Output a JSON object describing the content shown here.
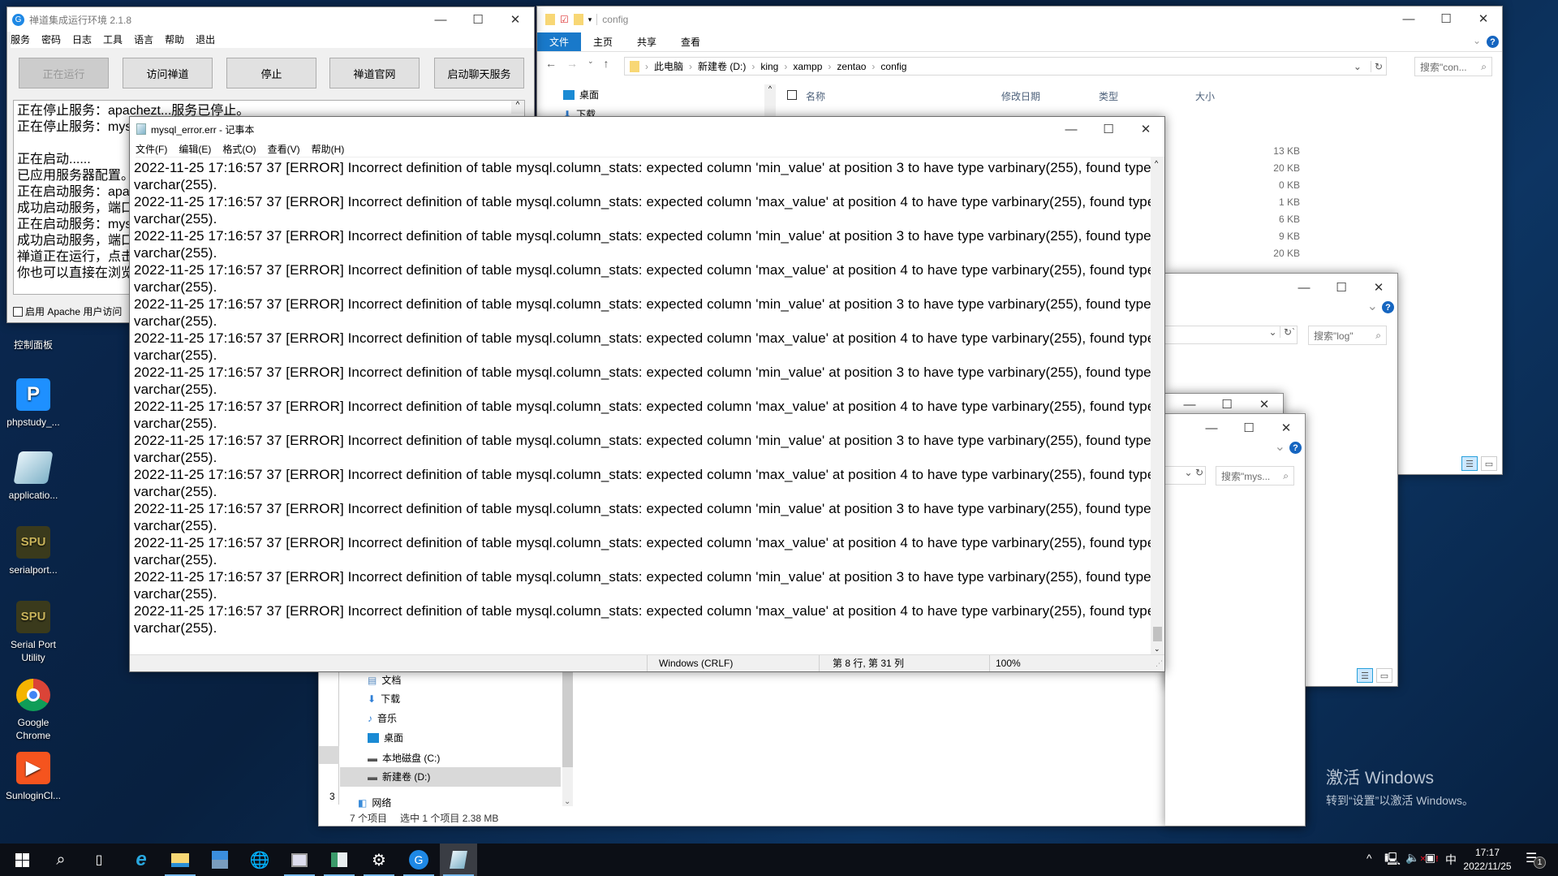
{
  "desktop": {
    "icons": [
      {
        "label": "控制面板",
        "icon": "control-panel-icon"
      },
      {
        "label": "phpstudy_...",
        "icon": "phpstudy-icon",
        "glyph": "P"
      },
      {
        "label": "applicatio...",
        "icon": "notepad-file-icon"
      },
      {
        "label": "serialport...",
        "icon": "serialport-icon",
        "glyph": "SPU"
      },
      {
        "label": "Serial Port Utility",
        "icon": "serialport-icon",
        "glyph": "SPU"
      },
      {
        "label": "Google Chrome",
        "icon": "chrome-icon"
      },
      {
        "label": "SunloginCl...",
        "icon": "sunlogin-icon"
      }
    ],
    "watermark": {
      "title": "激活 Windows",
      "subtitle": "转到“设置”以激活 Windows。"
    }
  },
  "zentao": {
    "title": "禅道集成运行环境 2.1.8",
    "menu": [
      "服务",
      "密码",
      "日志",
      "工具",
      "语言",
      "帮助",
      "退出"
    ],
    "buttons": [
      "正在运行",
      "访问禅道",
      "停止",
      "禅道官网",
      "启动聊天服务"
    ],
    "log": [
      "正在停止服务：apachezt...服务已停止。",
      "正在停止服务：mysql",
      "",
      "正在启动......",
      "已应用服务器配置。",
      "正在启动服务：apache",
      "成功启动服务，端口号",
      "正在启动服务：mysql",
      "成功启动服务，端口号",
      "禅道正在运行，点击“",
      "你也可以直接在浏览器"
    ],
    "checkbox_label": "启用 Apache 用户访问"
  },
  "notepad": {
    "title": "mysql_error.err - 记事本",
    "menu": [
      "文件(F)",
      "编辑(E)",
      "格式(O)",
      "查看(V)",
      "帮助(H)"
    ],
    "lines": [
      "2022-11-25 17:16:57 37 [ERROR] Incorrect definition of table mysql.column_stats: expected column 'min_value' at position 3 to have type varbinary(255), found type varchar(255).",
      "2022-11-25 17:16:57 37 [ERROR] Incorrect definition of table mysql.column_stats: expected column 'max_value' at position 4 to have type varbinary(255), found type varchar(255).",
      "2022-11-25 17:16:57 37 [ERROR] Incorrect definition of table mysql.column_stats: expected column 'min_value' at position 3 to have type varbinary(255), found type varchar(255).",
      "2022-11-25 17:16:57 37 [ERROR] Incorrect definition of table mysql.column_stats: expected column 'max_value' at position 4 to have type varbinary(255), found type varchar(255).",
      "2022-11-25 17:16:57 37 [ERROR] Incorrect definition of table mysql.column_stats: expected column 'min_value' at position 3 to have type varbinary(255), found type varchar(255).",
      "2022-11-25 17:16:57 37 [ERROR] Incorrect definition of table mysql.column_stats: expected column 'max_value' at position 4 to have type varbinary(255), found type varchar(255).",
      "2022-11-25 17:16:57 37 [ERROR] Incorrect definition of table mysql.column_stats: expected column 'min_value' at position 3 to have type varbinary(255), found type varchar(255).",
      "2022-11-25 17:16:57 37 [ERROR] Incorrect definition of table mysql.column_stats: expected column 'max_value' at position 4 to have type varbinary(255), found type varchar(255).",
      "2022-11-25 17:16:57 37 [ERROR] Incorrect definition of table mysql.column_stats: expected column 'min_value' at position 3 to have type varbinary(255), found type varchar(255).",
      "2022-11-25 17:16:57 37 [ERROR] Incorrect definition of table mysql.column_stats: expected column 'max_value' at position 4 to have type varbinary(255), found type varchar(255).",
      "2022-11-25 17:16:57 37 [ERROR] Incorrect definition of table mysql.column_stats: expected column 'min_value' at position 3 to have type varbinary(255), found type varchar(255).",
      "2022-11-25 17:16:57 37 [ERROR] Incorrect definition of table mysql.column_stats: expected column 'max_value' at position 4 to have type varbinary(255), found type varchar(255).",
      "2022-11-25 17:16:57 37 [ERROR] Incorrect definition of table mysql.column_stats: expected column 'min_value' at position 3 to have type varbinary(255), found type varchar(255).",
      "2022-11-25 17:16:57 37 [ERROR] Incorrect definition of table mysql.column_stats: expected column 'max_value' at position 4 to have type varbinary(255), found type varchar(255)."
    ],
    "status": {
      "encoding": "Windows (CRLF)",
      "position": "第 8 行, 第 31 列",
      "zoom": "100%"
    }
  },
  "explorer_config": {
    "title": "config",
    "tabs": [
      "文件",
      "主页",
      "共享",
      "查看"
    ],
    "breadcrumb": [
      "此电脑",
      "新建卷 (D:)",
      "king",
      "xampp",
      "zentao",
      "config"
    ],
    "search_placeholder": "搜索\"con...",
    "nav": [
      "桌面",
      "下载"
    ],
    "columns": [
      "名称",
      "修改日期",
      "类型",
      "大小"
    ],
    "sizes": [
      "13 KB",
      "20 KB",
      "0 KB",
      "1 KB",
      "6 KB",
      "9 KB",
      "20 KB"
    ]
  },
  "explorer_log": {
    "search_placeholder": "搜索\"log\""
  },
  "explorer_mys": {
    "search_placeholder": "搜索\"mys..."
  },
  "explorer_bottom": {
    "nav": [
      "文档",
      "下载",
      "音乐",
      "桌面",
      "本地磁盘 (C:)",
      "新建卷 (D:)",
      "网络"
    ],
    "left_fragment": "3",
    "status_count": "7 个项目",
    "status_selected": "选中 1 个项目  2.38 MB"
  },
  "taskbar": {
    "apps": [
      "start",
      "search",
      "task-view",
      "internet-explorer",
      "file-explorer",
      "server-manager",
      "network-globe",
      "performance-monitor",
      "window-app",
      "settings",
      "zentao",
      "notepad"
    ],
    "time": "17:17",
    "date": "2022/11/25",
    "ime": "中",
    "notifications": "1"
  }
}
